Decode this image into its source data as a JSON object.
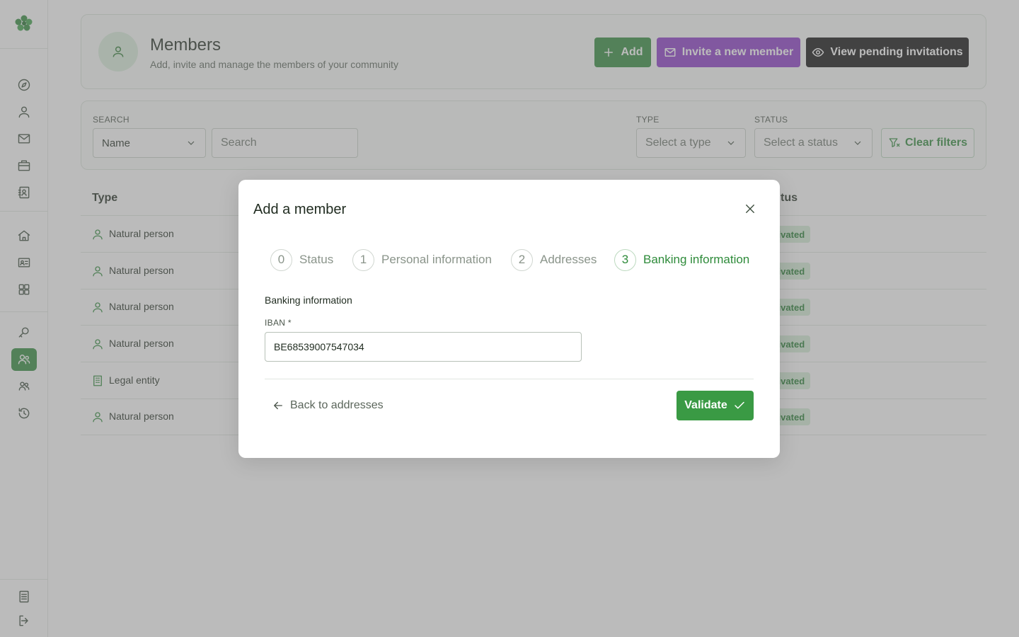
{
  "header": {
    "title": "Members",
    "subtitle": "Add, invite and manage the members of your community",
    "add_label": "Add",
    "invite_label": "Invite a new member",
    "pending_label": "View pending invitations"
  },
  "filters": {
    "search_label": "SEARCH",
    "search_field_value": "Name",
    "search_placeholder": "Search",
    "type_label": "TYPE",
    "type_placeholder": "Select a type",
    "status_label": "STATUS",
    "status_placeholder": "Select a status",
    "clear_label": "Clear filters"
  },
  "table": {
    "col_type": "Type",
    "col_status": "tus",
    "rows": [
      {
        "type": "Natural person",
        "icon": "person-icon",
        "status": "ctivated"
      },
      {
        "type": "Natural person",
        "icon": "person-icon",
        "status": "ctivated"
      },
      {
        "type": "Natural person",
        "icon": "person-icon",
        "status": "ctivated"
      },
      {
        "type": "Natural person",
        "icon": "person-icon",
        "status": "ctivated"
      },
      {
        "type": "Legal entity",
        "icon": "building-icon",
        "status": "ctivated"
      },
      {
        "type": "Natural person",
        "icon": "person-icon",
        "status": "ctivated"
      }
    ]
  },
  "modal": {
    "title": "Add a member",
    "steps": [
      {
        "number": "0",
        "label": "Status"
      },
      {
        "number": "1",
        "label": "Personal information"
      },
      {
        "number": "2",
        "label": "Addresses"
      },
      {
        "number": "3",
        "label": "Banking information"
      }
    ],
    "active_step": 3,
    "section_title": "Banking information",
    "iban_label": "IBAN *",
    "iban_value": "BE68539007547034",
    "back_label": "Back to addresses",
    "validate_label": "Validate"
  },
  "colors": {
    "primary_green": "#2e8b3a",
    "invite_purple": "#8a38c8",
    "pending_black": "#0d0d0d",
    "badge_bg": "#d5ecd6"
  }
}
